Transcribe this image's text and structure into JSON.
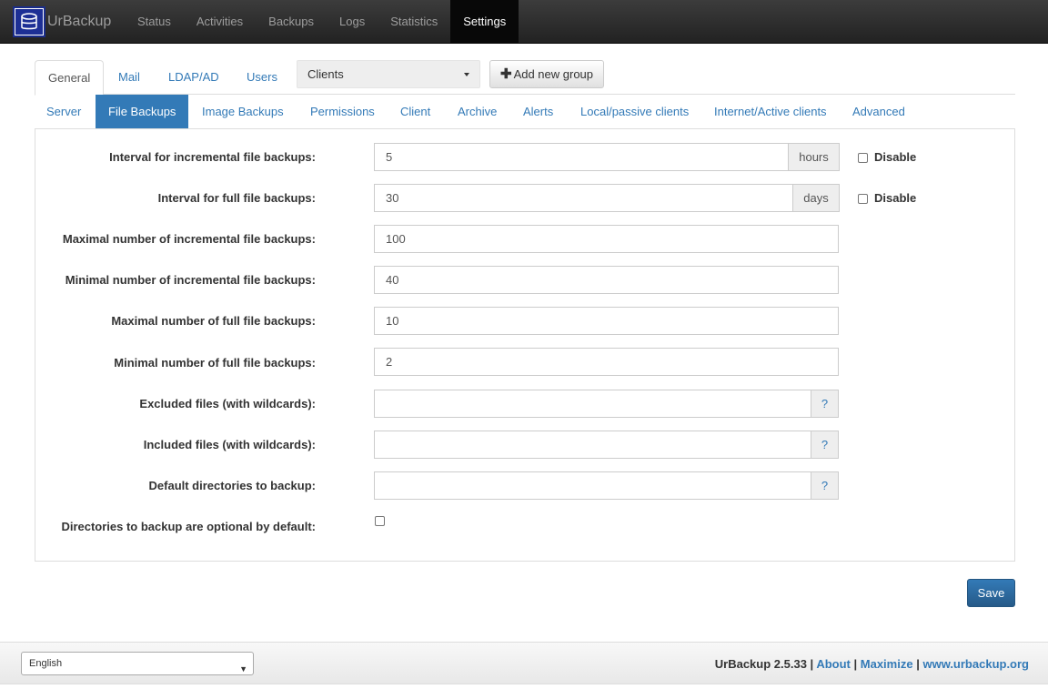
{
  "navbar": {
    "brand": "UrBackup",
    "links": [
      "Status",
      "Activities",
      "Backups",
      "Logs",
      "Statistics",
      "Settings"
    ],
    "active": "Settings"
  },
  "tabs_top": [
    "General",
    "Mail",
    "LDAP/AD",
    "Users"
  ],
  "group_select": "Clients",
  "add_group_label": "Add new group",
  "tabs_sub": [
    "Server",
    "File Backups",
    "Image Backups",
    "Permissions",
    "Client",
    "Archive",
    "Alerts",
    "Local/passive clients",
    "Internet/Active clients",
    "Advanced"
  ],
  "form": {
    "incr_interval_label": "Interval for incremental file backups:",
    "incr_interval_value": "5",
    "incr_interval_unit": "hours",
    "full_interval_label": "Interval for full file backups:",
    "full_interval_value": "30",
    "full_interval_unit": "days",
    "disable_label": "Disable",
    "max_incr_label": "Maximal number of incremental file backups:",
    "max_incr_value": "100",
    "min_incr_label": "Minimal number of incremental file backups:",
    "min_incr_value": "40",
    "max_full_label": "Maximal number of full file backups:",
    "max_full_value": "10",
    "min_full_label": "Minimal number of full file backups:",
    "min_full_value": "2",
    "excluded_label": "Excluded files (with wildcards):",
    "included_label": "Included files (with wildcards):",
    "default_dirs_label": "Default directories to backup:",
    "help_mark": "?",
    "optional_label": "Directories to backup are optional by default:"
  },
  "save_label": "Save",
  "footer": {
    "language": "English",
    "version": "UrBackup 2.5.33 |",
    "about": "About",
    "sep": "|",
    "maximize": "Maximize",
    "site": "www.urbackup.org"
  }
}
